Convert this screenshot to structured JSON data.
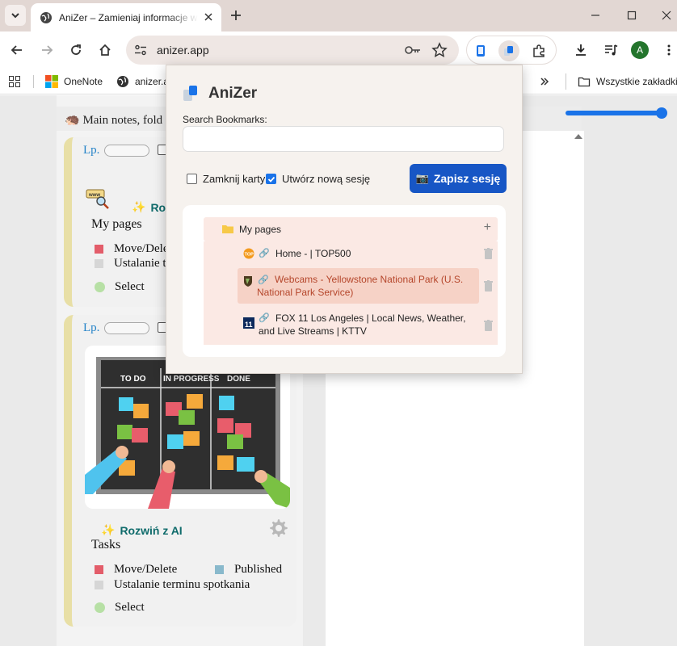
{
  "browser": {
    "tab_title": "AniZer – Zamieniaj informacje w",
    "url": "anizer.app",
    "avatar_letter": "A"
  },
  "bookmarks_bar": {
    "items": [
      {
        "label": "OneNote"
      },
      {
        "label": "anizer.a"
      }
    ],
    "all_bookmarks": "Wszystkie zakładki"
  },
  "page": {
    "header_text": "Main notes, fold",
    "cards": [
      {
        "lp_label": "Lp.",
        "ai_label": "Roz",
        "title": "My pages",
        "legend": [
          {
            "label": "Move/Delete",
            "color": "#e35d6a"
          },
          {
            "label": "Ustalanie te",
            "color": "#d6d6d6"
          }
        ],
        "select_label": "Select"
      },
      {
        "lp_label": "Lp.",
        "ai_label": "Rozwiń z AI",
        "title": "Tasks",
        "legend": [
          {
            "label": "Move/Delete",
            "color": "#e35d6a"
          },
          {
            "label": "Published",
            "color": "#89b9cc"
          },
          {
            "label": "Ustalanie terminu spotkania",
            "color": "#d6d6d6"
          }
        ],
        "select_label": "Select",
        "image": {
          "columns": [
            "TO DO",
            "IN PROGRESS",
            "DONE"
          ]
        }
      }
    ]
  },
  "popup": {
    "title": "AniZer",
    "search_label": "Search Bookmarks:",
    "search_value": "",
    "close_tabs_label": "Zamknij karty",
    "close_tabs_checked": false,
    "new_session_label": "Utwórz nową sesję",
    "new_session_checked": true,
    "save_button": "Zapisz sesję",
    "tree": {
      "folder": "My pages",
      "add_symbol": "+",
      "items": [
        {
          "title_line1": "Home - | TOP500",
          "title_line2": "",
          "favicon": "top500-icon",
          "selected": false
        },
        {
          "title_line1": "Webcams - Yellowstone National Park (U.S.",
          "title_line2": "National Park Service)",
          "favicon": "nps-arrowhead-icon",
          "selected": true
        },
        {
          "title_line1": "FOX 11 Los Angeles | Local News, Weather,",
          "title_line2": "and Live Streams | KTTV",
          "favicon": "fox11-icon",
          "selected": false
        }
      ]
    }
  },
  "colors": {
    "accent_blue": "#1756c5",
    "card_stripe": "#e8dfa6",
    "link_teal": "#0f6b6b",
    "selected_text": "#b5462b"
  }
}
